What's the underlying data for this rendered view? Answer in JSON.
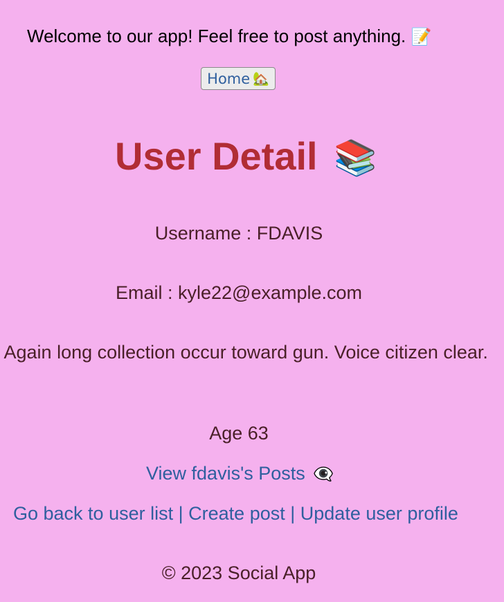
{
  "header": {
    "welcome_text": "Welcome to our app! Feel free to post anything.",
    "welcome_emoji": "📝",
    "home_button_label": "Home",
    "home_button_emoji": "🏡"
  },
  "main": {
    "title": "User Detail",
    "title_emoji": "📚",
    "username_label": "Username : FDAVIS",
    "email_label": "Email : kyle22@example.com",
    "bio": ". Again long collection occur toward gun. Voice citizen clear.",
    "age_label": "Age 63",
    "view_posts_label": "View fdavis's Posts",
    "view_posts_emoji": "👁️‍🗨️"
  },
  "nav": {
    "back_to_list": "Go back to user list",
    "separator": "|",
    "create_post": "Create post",
    "update_profile": "Update user profile"
  },
  "footer": {
    "copyright": "© 2023 Social App"
  },
  "colors": {
    "background": "#f5b1ee",
    "title": "#b12d35",
    "link": "#2f5f9e",
    "text": "#4a2028"
  }
}
